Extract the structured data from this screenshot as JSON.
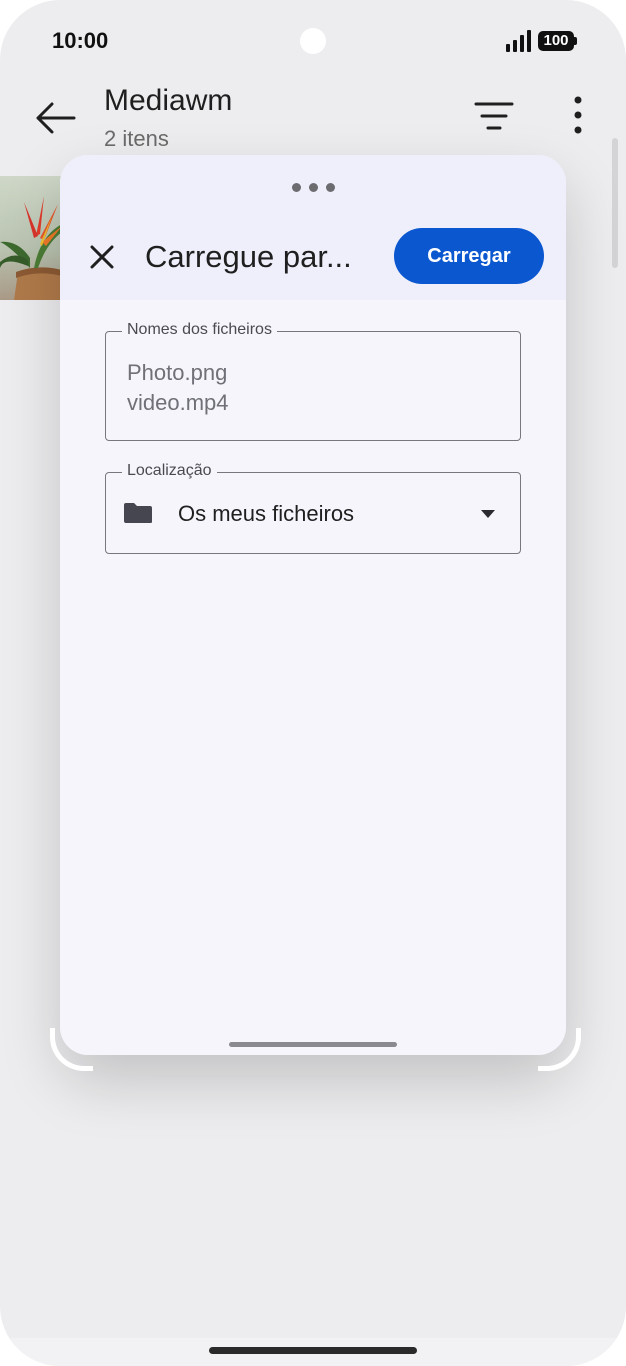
{
  "status_bar": {
    "time": "10:00",
    "battery": "100"
  },
  "app_bar": {
    "title": "Mediawm",
    "subtitle": "2 itens",
    "back_icon": "arrow-left-icon",
    "filter_icon": "filter-icon",
    "more_icon": "more-vert-icon"
  },
  "sheet": {
    "title": "Carregue par...",
    "upload_label": "Carregar",
    "file_names": {
      "label": "Nomes dos ficheiros",
      "items": [
        "Photo.png",
        "video.mp4"
      ]
    },
    "location": {
      "label": "Localização",
      "value": "Os meus ficheiros",
      "icon": "folder-icon"
    }
  },
  "colors": {
    "accent": "#0b57d0",
    "sheet_bg": "#f6f5fc",
    "screen_bg": "#ededef"
  }
}
